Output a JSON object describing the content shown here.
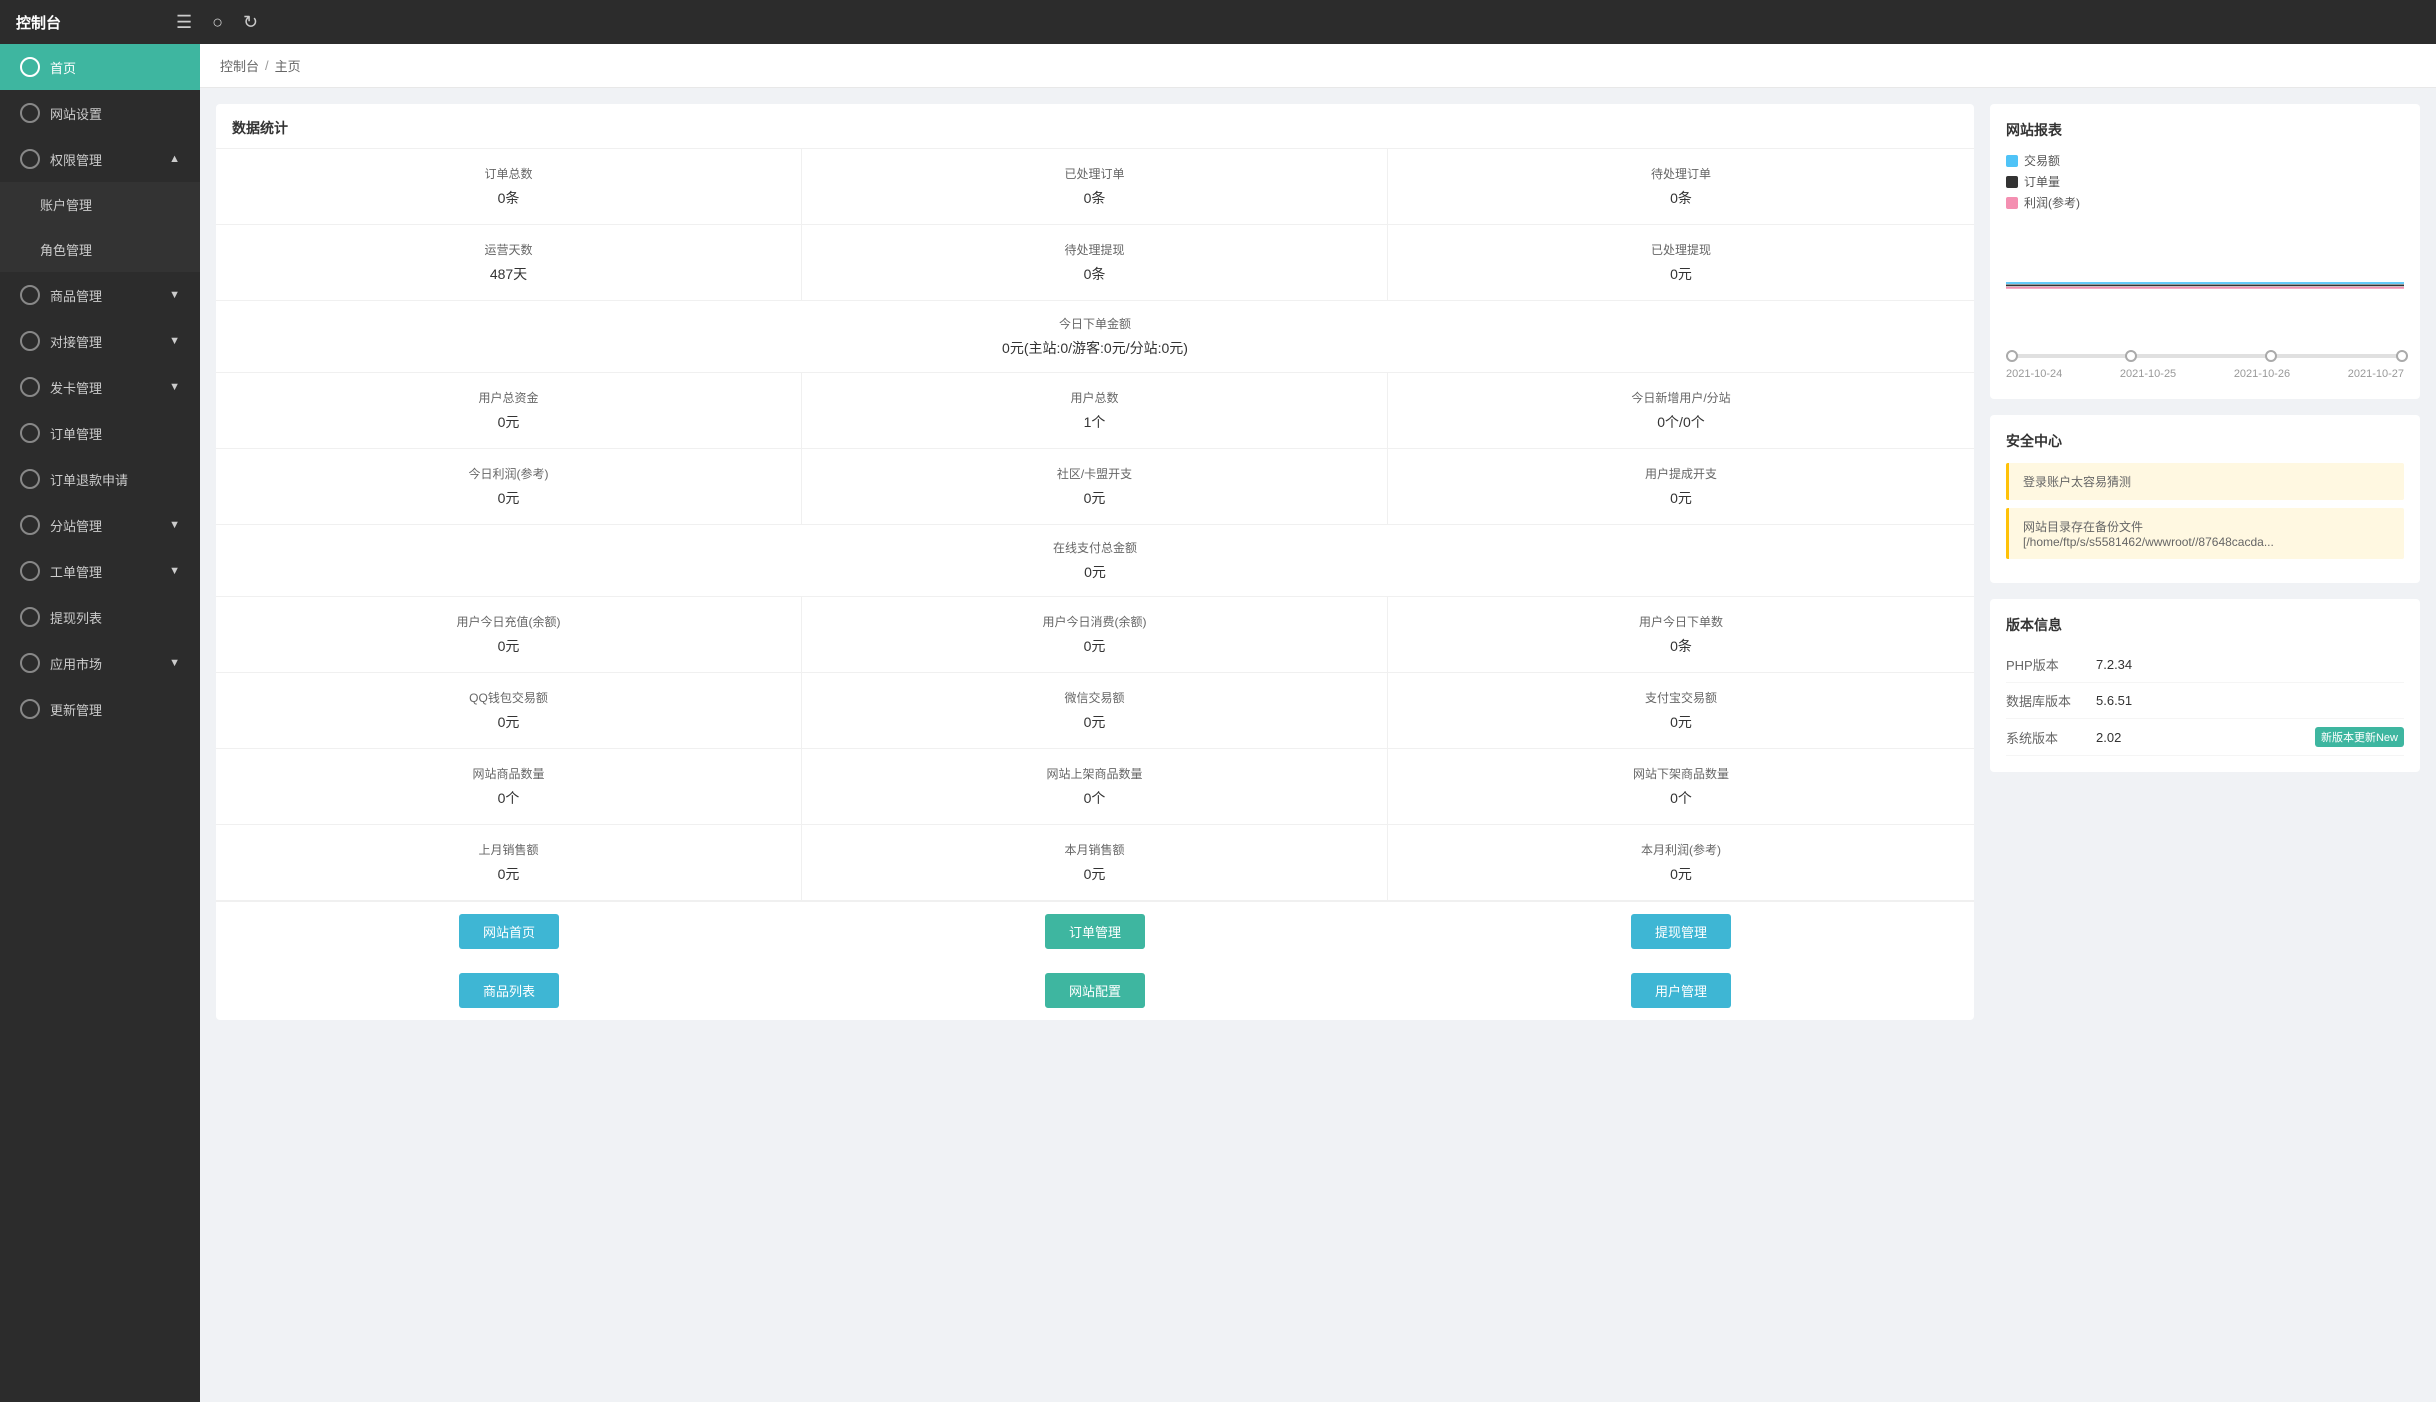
{
  "topbar": {
    "title": "控制台",
    "icon_menu": "≡",
    "icon_globe": "🌐",
    "icon_refresh": "↻"
  },
  "breadcrumb": {
    "items": [
      "控制台",
      "主页"
    ]
  },
  "sidebar": {
    "items": [
      {
        "id": "home",
        "label": "首页",
        "active": true,
        "hasArrow": false,
        "hasSub": false
      },
      {
        "id": "site-settings",
        "label": "网站设置",
        "active": false,
        "hasArrow": false,
        "hasSub": false
      },
      {
        "id": "perm-mgmt",
        "label": "权限管理",
        "active": false,
        "hasArrow": true,
        "hasSub": true,
        "sub": [
          "账户管理",
          "角色管理"
        ]
      },
      {
        "id": "goods-mgmt",
        "label": "商品管理",
        "active": false,
        "hasArrow": true,
        "hasSub": false
      },
      {
        "id": "connect-mgmt",
        "label": "对接管理",
        "active": false,
        "hasArrow": true,
        "hasSub": false
      },
      {
        "id": "card-mgmt",
        "label": "发卡管理",
        "active": false,
        "hasArrow": true,
        "hasSub": false
      },
      {
        "id": "order-mgmt",
        "label": "订单管理",
        "active": false,
        "hasArrow": false,
        "hasSub": false
      },
      {
        "id": "refund-mgmt",
        "label": "订单退款申请",
        "active": false,
        "hasArrow": false,
        "hasSub": false
      },
      {
        "id": "branch-mgmt",
        "label": "分站管理",
        "active": false,
        "hasArrow": true,
        "hasSub": false
      },
      {
        "id": "work-order",
        "label": "工单管理",
        "active": false,
        "hasArrow": true,
        "hasSub": false
      },
      {
        "id": "withdraw-list",
        "label": "提现列表",
        "active": false,
        "hasArrow": false,
        "hasSub": false
      },
      {
        "id": "app-market",
        "label": "应用市场",
        "active": false,
        "hasArrow": true,
        "hasSub": false
      },
      {
        "id": "update-mgmt",
        "label": "更新管理",
        "active": false,
        "hasArrow": false,
        "hasSub": false
      }
    ]
  },
  "stats": {
    "title": "数据统计",
    "cells": [
      {
        "label": "订单总数",
        "value": "0条"
      },
      {
        "label": "已处理订单",
        "value": "0条"
      },
      {
        "label": "待处理订单",
        "value": "0条"
      },
      {
        "label": "运营天数",
        "value": "487天"
      },
      {
        "label": "待处理提现",
        "value": "0条"
      },
      {
        "label": "已处理提现",
        "value": "0元"
      }
    ],
    "today_order": {
      "label": "今日下单金额",
      "value": "0元(主站:0/游客:0元/分站:0元)"
    },
    "cells2": [
      {
        "label": "用户总资金",
        "value": "0元"
      },
      {
        "label": "用户总数",
        "value": "1个"
      },
      {
        "label": "今日新增用户/分站",
        "value": "0个/0个"
      },
      {
        "label": "今日利润(参考)",
        "value": "0元"
      },
      {
        "label": "社区/卡盟开支",
        "value": "0元"
      },
      {
        "label": "用户提成开支",
        "value": "0元"
      }
    ],
    "online_pay": {
      "label": "在线支付总金额",
      "value": "0元"
    },
    "cells3": [
      {
        "label": "用户今日充值(余额)",
        "value": "0元"
      },
      {
        "label": "用户今日消费(余额)",
        "value": "0元"
      },
      {
        "label": "用户今日下单数",
        "value": "0条"
      },
      {
        "label": "QQ钱包交易额",
        "value": "0元"
      },
      {
        "label": "微信交易额",
        "value": "0元"
      },
      {
        "label": "支付宝交易额",
        "value": "0元"
      },
      {
        "label": "网站商品数量",
        "value": "0个"
      },
      {
        "label": "网站上架商品数量",
        "value": "0个"
      },
      {
        "label": "网站下架商品数量",
        "value": "0个"
      },
      {
        "label": "上月销售额",
        "value": "0元"
      },
      {
        "label": "本月销售额",
        "value": "0元"
      },
      {
        "label": "本月利润(参考)",
        "value": "0元"
      }
    ],
    "buttons": [
      {
        "label": "网站首页",
        "color": "blue"
      },
      {
        "label": "订单管理",
        "color": "teal"
      },
      {
        "label": "提现管理",
        "color": "blue"
      },
      {
        "label": "商品列表",
        "color": "blue"
      },
      {
        "label": "网站配置",
        "color": "teal"
      },
      {
        "label": "用户管理",
        "color": "blue"
      }
    ]
  },
  "chart": {
    "title": "网站报表",
    "legend": [
      {
        "label": "交易额",
        "color": "#4fc3f7"
      },
      {
        "label": "订单量",
        "color": "#333"
      },
      {
        "label": "利润(参考)",
        "color": "#f48fb1"
      }
    ],
    "xaxis": [
      "2021-10-24",
      "2021-10-25",
      "2021-10-26",
      "2021-10-27"
    ],
    "slider_positions": [
      0,
      30,
      65,
      100
    ]
  },
  "security": {
    "title": "安全中心",
    "alerts": [
      "登录账户太容易猜测",
      "网站目录存在备份文件 [/home/ftp/s/s5581462/wwwroot//87648cacda..."
    ]
  },
  "version": {
    "title": "版本信息",
    "rows": [
      {
        "label": "PHP版本",
        "value": "7.2.34",
        "badge": null
      },
      {
        "label": "数据库版本",
        "value": "5.6.51",
        "badge": null
      },
      {
        "label": "系统版本",
        "value": "2.02",
        "badge": "新版本更新New"
      }
    ]
  }
}
